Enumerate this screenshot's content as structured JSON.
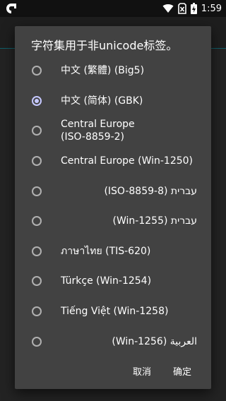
{
  "status_bar": {
    "time": "1:59"
  },
  "dialog": {
    "title": "字符集用于非unicode标签。",
    "options": [
      {
        "label": "中文 (繁體) (Big5)",
        "checked": false,
        "rtl": false
      },
      {
        "label": "中文 (简体) (GBK)",
        "checked": true,
        "rtl": false
      },
      {
        "label": "Central Europe\n(ISO-8859-2)",
        "checked": false,
        "rtl": false
      },
      {
        "label": "Central Europe (Win-1250)",
        "checked": false,
        "rtl": false
      },
      {
        "label": "עברית (ISO-8859-8)",
        "checked": false,
        "rtl": true
      },
      {
        "label": "עברית (Win-1255)",
        "checked": false,
        "rtl": true
      },
      {
        "label": "ภาษาไทย (TIS-620)",
        "checked": false,
        "rtl": false
      },
      {
        "label": "Türkçe (Win-1254)",
        "checked": false,
        "rtl": false
      },
      {
        "label": "Tiếng Việt (Win-1258)",
        "checked": false,
        "rtl": false
      },
      {
        "label": "العربية (Win-1256)",
        "checked": false,
        "rtl": true
      }
    ],
    "cancel_label": "取消",
    "ok_label": "确定"
  }
}
